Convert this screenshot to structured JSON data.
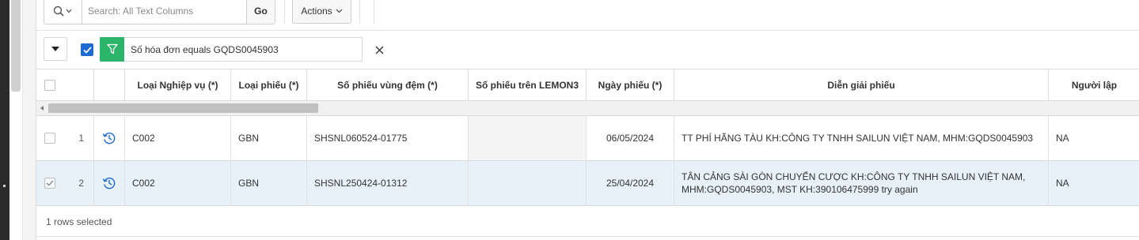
{
  "toolbar": {
    "search_placeholder": "Search: All Text Columns",
    "go_label": "Go",
    "actions_label": "Actions"
  },
  "filter": {
    "text": "Số hóa đơn equals GQDS0045903",
    "enabled": true
  },
  "columns": [
    "Loại Nghiệp vụ (*)",
    "Loại phiếu (*)",
    "Số phiếu vùng đệm (*)",
    "Số phiếu trên LEMON3",
    "Ngày phiếu (*)",
    "Diễn giải phiếu",
    "Người lập"
  ],
  "rows": [
    {
      "num": "1",
      "selected": false,
      "nghiep_vu": "C002",
      "loai_phieu": "GBN",
      "so_phieu_vung_dem": "SHSNL060524-01775",
      "so_phieu_lemon3": "",
      "ngay_phieu": "06/05/2024",
      "dien_giai": "TT PHÍ HÃNG TÀU KH:CÔNG TY TNHH SAILUN VIỆT NAM, MHM:GQDS0045903",
      "nguoi_lap": "NA"
    },
    {
      "num": "2",
      "selected": true,
      "nghiep_vu": "C002",
      "loai_phieu": "GBN",
      "so_phieu_vung_dem": "SHSNL250424-01312",
      "so_phieu_lemon3": "",
      "ngay_phieu": "25/04/2024",
      "dien_giai": "TÂN CẢNG SÀI GÒN CHUYỂN CƯỢC KH:CÔNG TY TNHH SAILUN VIỆT NAM, MHM:GQDS0045903, MST KH:390106475999 try again",
      "nguoi_lap": "NA"
    }
  ],
  "footer": {
    "selection_text": "1 rows selected"
  },
  "colors": {
    "filter_icon_bg": "#2bb56b",
    "checkbox_checked": "#1d6bd1",
    "history_icon": "#1d6bd1",
    "selected_row_bg": "#e8f0f8"
  }
}
